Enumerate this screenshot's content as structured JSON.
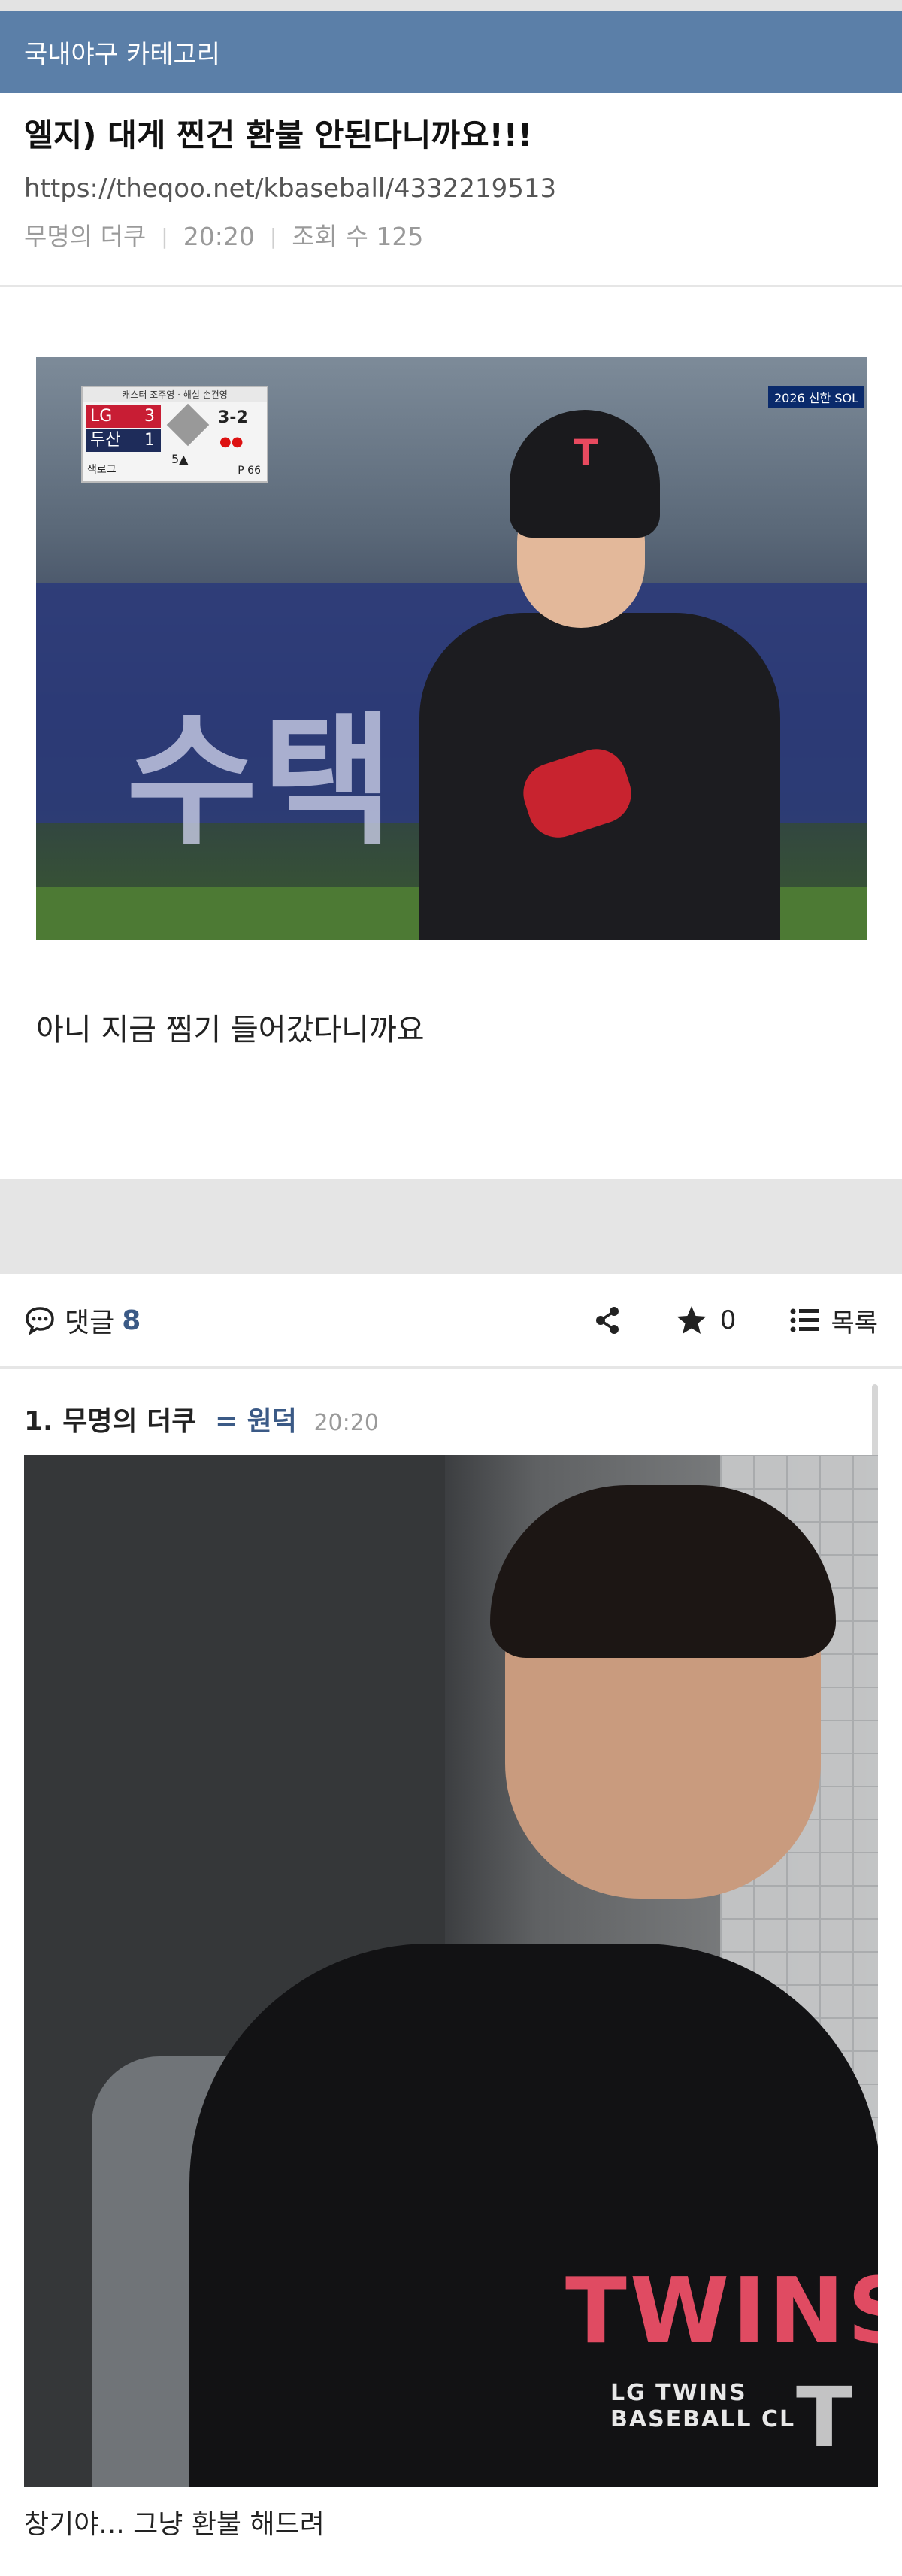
{
  "category_bar": {
    "title": "국내야구 카테고리"
  },
  "post": {
    "title": "엘지) 대게 찐건 환불 안된다니까요!!!",
    "url": "https://theqoo.net/kbaseball/4332219513",
    "author": "무명의 더쿠",
    "time": "20:20",
    "views_label": "조회 수 125",
    "body_text": "아니 지금 찜기 들어갔다니까요"
  },
  "photo1": {
    "scoreboard": {
      "header": "캐스터 조주영 · 해설 손건영",
      "team1": "LG",
      "score1": "3",
      "team2": "두산",
      "score2": "1",
      "inning": "5▲",
      "count": "3-2",
      "outs": "●●",
      "pitcher": "잭로그",
      "pitch_count": "P 66"
    },
    "broadcaster": "2026 신한 SOL",
    "banner_text": "수택",
    "helmet_logo": "T"
  },
  "comments_bar": {
    "comment_label": "댓글",
    "comment_count": "8",
    "star_count": "0",
    "list_label": "목록",
    "icons": [
      "comment-icon",
      "share-icon",
      "star-icon",
      "list-icon"
    ]
  },
  "comments": [
    {
      "number": "1.",
      "author": "무명의 더쿠",
      "badge": "= 원덕",
      "time": "20:20",
      "photo": {
        "shirt_text": "TWINS",
        "shirt_sub": "LG TWINS BASEBALL CL",
        "watermark": "T"
      },
      "text": "창기야... 그냥 환불 해드려"
    }
  ],
  "colors": {
    "category_bar": "#5b7fa8",
    "accent": "#3b5a86",
    "twins_red": "#e04b62"
  }
}
